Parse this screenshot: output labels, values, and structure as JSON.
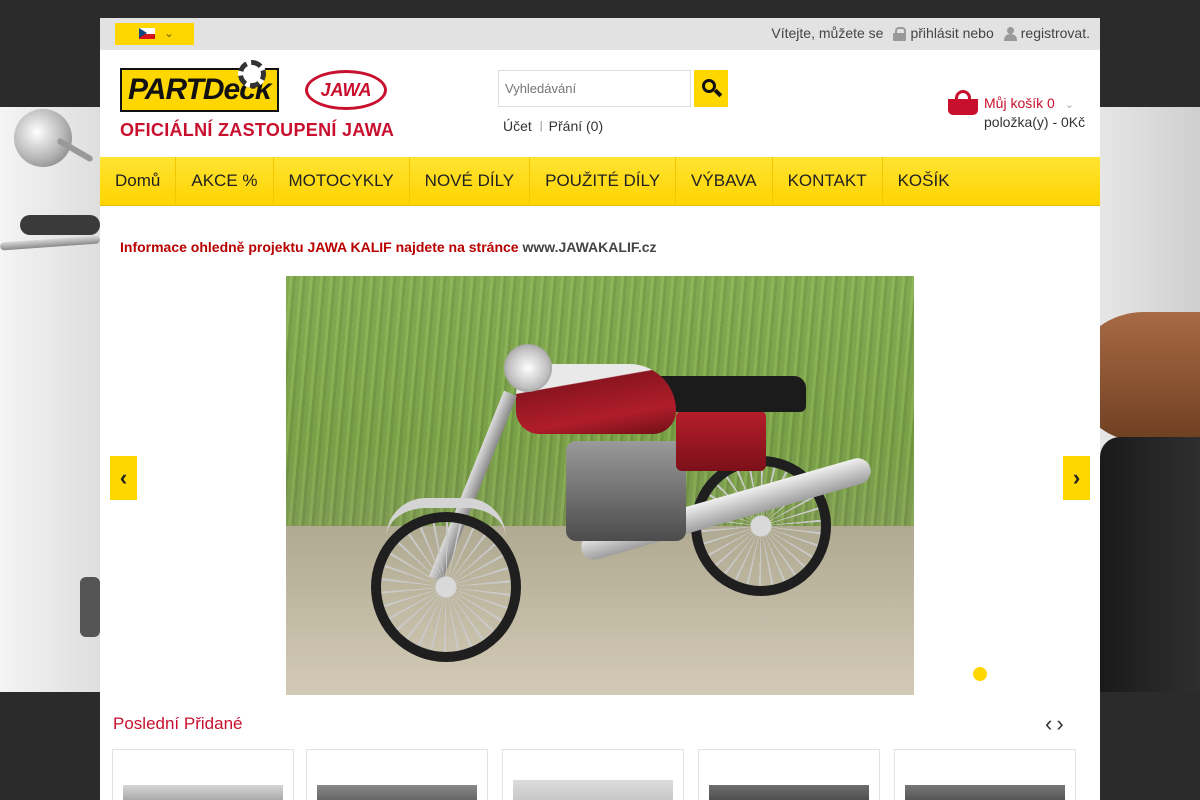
{
  "topbar": {
    "welcome_text": "Vítejte, můžete se",
    "login_link": "přihlásit nebo",
    "register_link": "registrovat."
  },
  "header": {
    "logo_brand": "PARTDeck",
    "logo_jawa": "JAWA",
    "logo_subtitle": "OFICIÁLNÍ ZASTOUPENÍ JAWA",
    "search_placeholder": "Vyhledávání",
    "account_link": "Účet",
    "wishlist_link": "Přání (0)",
    "cart_title": "Můj košík",
    "cart_count": "0",
    "cart_summary": "položka(y) - 0Kč"
  },
  "nav": {
    "items": [
      {
        "label": "Domů"
      },
      {
        "label": "AKCE %"
      },
      {
        "label": "MOTOCYKLY"
      },
      {
        "label": "NOVÉ DÍLY"
      },
      {
        "label": "POUŽITÉ DÍLY"
      },
      {
        "label": "VÝBAVA"
      },
      {
        "label": "KONTAKT"
      },
      {
        "label": "KOŠÍK"
      }
    ]
  },
  "main": {
    "info_text": "Informace ohledně projektu JAWA KALIF najdete na stránce",
    "info_url": "www.JAWAKALIF.cz",
    "slider_prev": "‹",
    "slider_next": "›",
    "recent_title": "Poslední Přidané"
  },
  "colors": {
    "accent_yellow": "#ffd700",
    "brand_red": "#c8102e"
  },
  "icons": [
    "cz-flag-icon",
    "chevron-down-icon",
    "lock-icon",
    "user-icon",
    "search-icon",
    "basket-icon",
    "chevron-left-icon",
    "chevron-right-icon"
  ]
}
